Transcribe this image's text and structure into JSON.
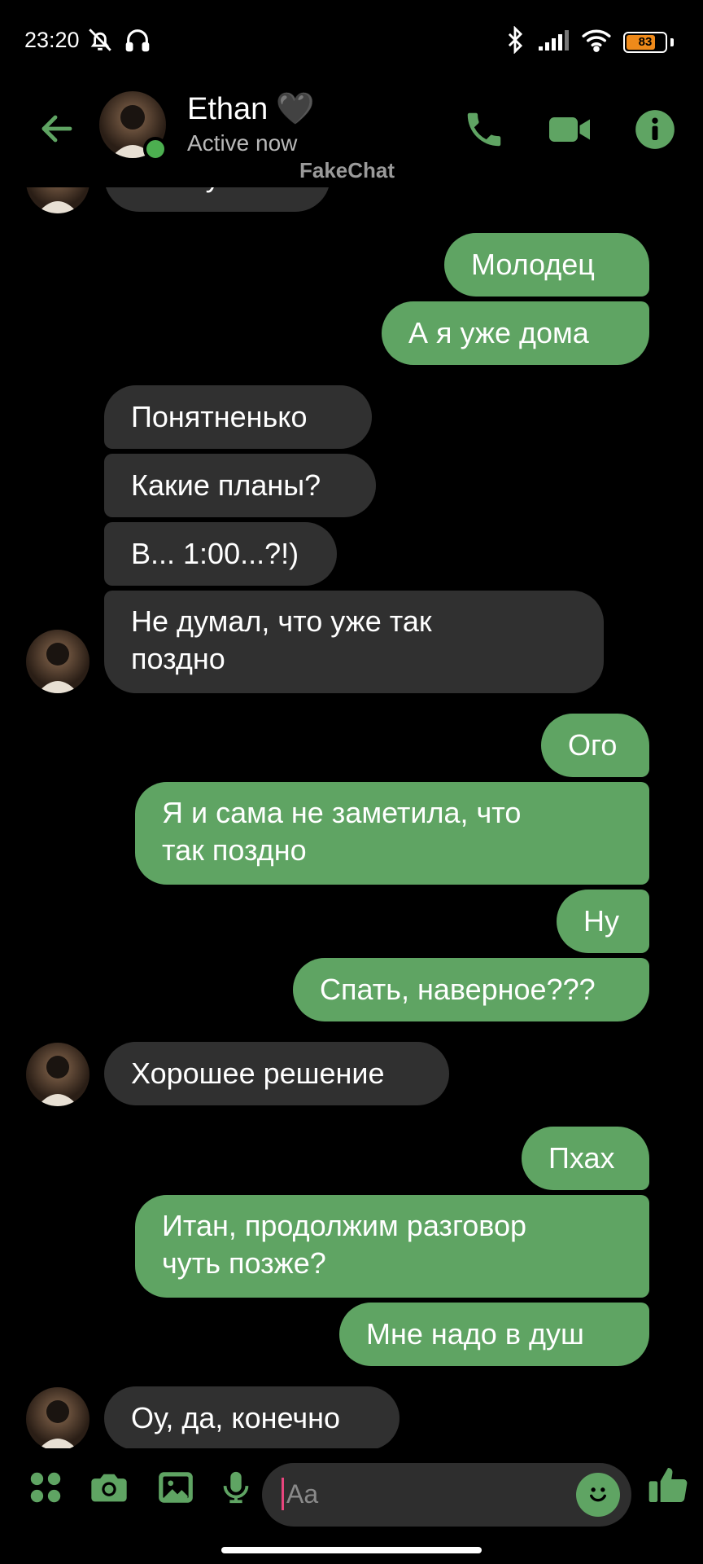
{
  "status_bar": {
    "time": "23:20",
    "battery": "83",
    "battery_level": 0.83,
    "left_icons": [
      "mute-bell-icon",
      "headphones-icon"
    ],
    "right_icons": [
      "bluetooth-icon",
      "signal-icon",
      "wifi-icon",
      "battery-icon"
    ]
  },
  "header": {
    "contact_name": "Ethan",
    "name_emoji": "🖤",
    "status": "Active now",
    "watermark": "FakeChat",
    "icons": [
      "back-arrow-icon",
      "phone-icon",
      "video-camera-icon",
      "info-icon"
    ]
  },
  "messages": [
    {
      "dir": "in",
      "text": "Я покушал",
      "partial": true
    },
    {
      "dir": "out",
      "text": "Молодец"
    },
    {
      "dir": "out",
      "text": "А я уже дома"
    },
    {
      "dir": "in",
      "text": "Понятненько"
    },
    {
      "dir": "in",
      "text": "Какие планы?"
    },
    {
      "dir": "in",
      "text": "В... 1:00...?!)"
    },
    {
      "dir": "in",
      "text": "Не думал, что уже так поздно",
      "lines": [
        "Не думал, что уже так",
        "поздно"
      ]
    },
    {
      "dir": "out",
      "text": "Ого"
    },
    {
      "dir": "out",
      "text": "Я и сама не заметила, что так поздно",
      "lines": [
        "Я и сама не заметила, что",
        "так поздно"
      ]
    },
    {
      "dir": "out",
      "text": "Ну"
    },
    {
      "dir": "out",
      "text": "Спать, наверное???"
    },
    {
      "dir": "in",
      "text": "Хорошее решение"
    },
    {
      "dir": "out",
      "text": "Пхах"
    },
    {
      "dir": "out",
      "text": "Итан, продолжим разговор чуть позже?",
      "lines": [
        "Итан, продолжим разговор",
        "чуть позже?"
      ]
    },
    {
      "dir": "out",
      "text": "Мне надо в душ"
    },
    {
      "dir": "in",
      "text": "Оу, да, конечно"
    }
  ],
  "composer": {
    "placeholder": "Aa",
    "icons": [
      "apps-grid-icon",
      "camera-icon",
      "gallery-icon",
      "microphone-icon",
      "emoji-icon",
      "thumbs-up-icon"
    ]
  },
  "colors": {
    "accent": "#5fa463",
    "incoming_bubble": "#303030",
    "background": "#000000",
    "online": "#4caf50",
    "battery": "#ef8a1a"
  }
}
